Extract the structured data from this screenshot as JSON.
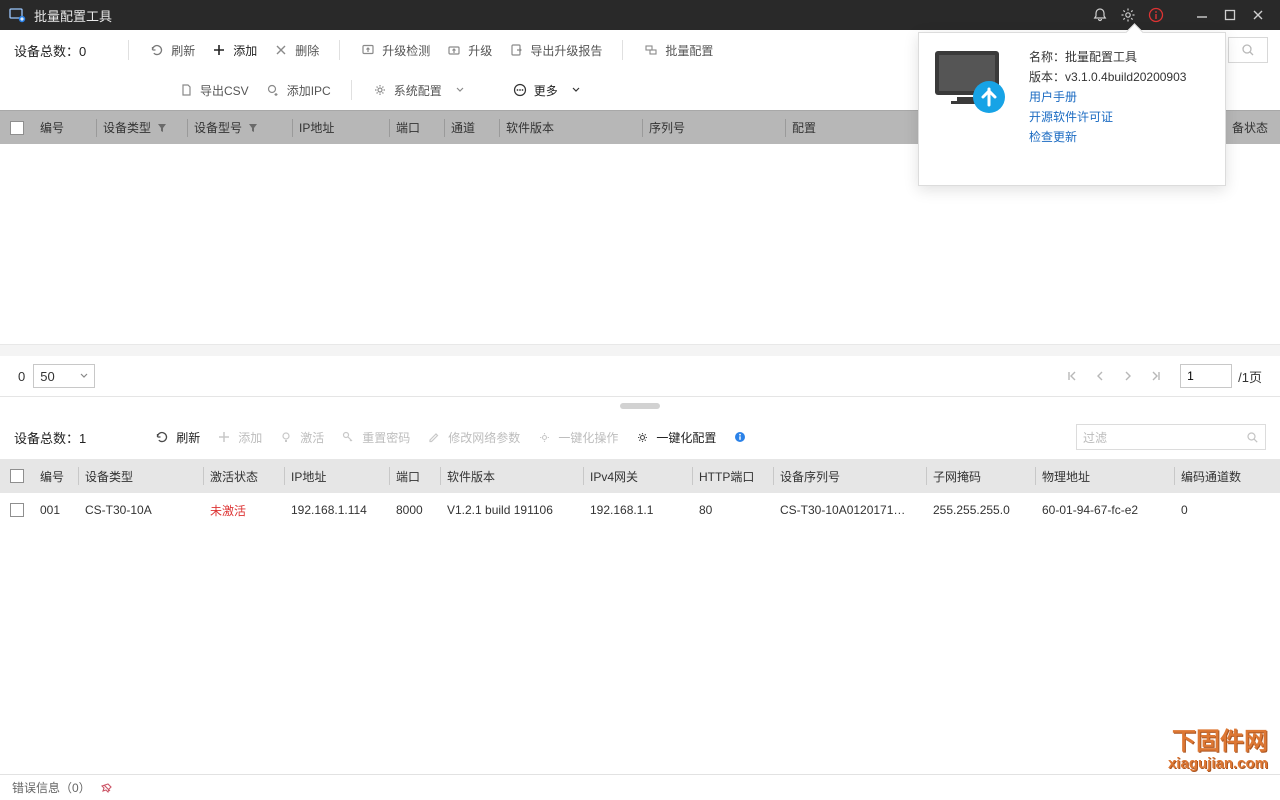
{
  "app": {
    "title": "批量配置工具"
  },
  "about": {
    "name_label": "名称：",
    "name": "批量配置工具",
    "ver_label": "版本：",
    "version": "v3.1.0.4build20200903",
    "link_manual": "用户手册",
    "link_license": "开源软件许可证",
    "link_update": "检查更新"
  },
  "upper": {
    "count_label": "设备总数：0",
    "btn_refresh": "刷新",
    "btn_add": "添加",
    "btn_delete": "删除",
    "btn_upgrade_check": "升级检测",
    "btn_upgrade": "升级",
    "btn_export_report": "导出升级报告",
    "btn_batch_config": "批量配置",
    "btn_export_csv": "导出CSV",
    "btn_add_ipc": "添加IPC",
    "btn_sys_config": "系统配置",
    "btn_more": "更多",
    "headers": {
      "id": "编号",
      "dev_type": "设备类型",
      "model": "设备型号",
      "ip": "IP地址",
      "port": "端口",
      "channel": "通道",
      "sw": "软件版本",
      "serial": "序列号",
      "config": "配置",
      "status": "状态"
    },
    "config_truncated": "备状态"
  },
  "pagination": {
    "start": "0",
    "page_size": "50",
    "page_input": "1",
    "total_suffix": "/1页"
  },
  "lower": {
    "count_label": "设备总数：1",
    "btn_refresh": "刷新",
    "btn_add": "添加",
    "btn_activate": "激活",
    "btn_reset_pw": "重置密码",
    "btn_modify_net": "修改网络参数",
    "btn_onekey_op": "一键化操作",
    "btn_onekey_cfg": "一键化配置",
    "filter_ph": "过滤",
    "headers": {
      "id": "编号",
      "type": "设备类型",
      "act": "激活状态",
      "ip": "IP地址",
      "port": "端口",
      "sw": "软件版本",
      "gw": "IPv4网关",
      "http": "HTTP端口",
      "serial": "设备序列号",
      "mask": "子网掩码",
      "mac": "物理地址",
      "ch": "编码通道数"
    },
    "row": {
      "id": "001",
      "type": "CS-T30-10A",
      "act": "未激活",
      "ip": "192.168.1.114",
      "port": "8000",
      "sw": "V1.2.1 build 191106",
      "gw": "192.168.1.1",
      "http": "80",
      "serial": "CS-T30-10A0120171…",
      "mask": "255.255.255.0",
      "mac": "60-01-94-67-fc-e2",
      "ch": "0"
    }
  },
  "footer": {
    "err": "错误信息（0）"
  },
  "watermark": {
    "l1": "下固件网",
    "l2": "xiagujian.com"
  }
}
